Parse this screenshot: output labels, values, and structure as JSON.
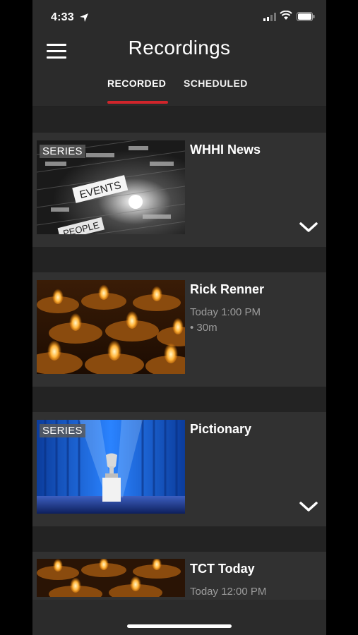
{
  "status_bar": {
    "time": "4:33"
  },
  "header": {
    "title": "Recordings",
    "tabs": [
      {
        "label": "RECORDED",
        "active": true
      },
      {
        "label": "SCHEDULED",
        "active": false
      }
    ]
  },
  "colors": {
    "accent": "#d0252b",
    "background": "#2b2b2b",
    "card": "#313131",
    "subtext": "#9c9c9c"
  },
  "recordings": [
    {
      "title": "WHHI News",
      "badge": "SERIES",
      "thumbnail": "events-wordcloud",
      "line1": "",
      "line2": "",
      "expandable": true
    },
    {
      "title": "Rick Renner",
      "badge": "",
      "thumbnail": "candles",
      "line1": "Today 1:00 PM",
      "line2": "• 30m",
      "expandable": false
    },
    {
      "title": "Pictionary",
      "badge": "SERIES",
      "thumbnail": "stage-trophy",
      "line1": "",
      "line2": "",
      "expandable": true
    },
    {
      "title": "TCT Today",
      "badge": "",
      "thumbnail": "candles",
      "line1": "Today 12:00 PM",
      "line2": "",
      "expandable": false
    }
  ]
}
